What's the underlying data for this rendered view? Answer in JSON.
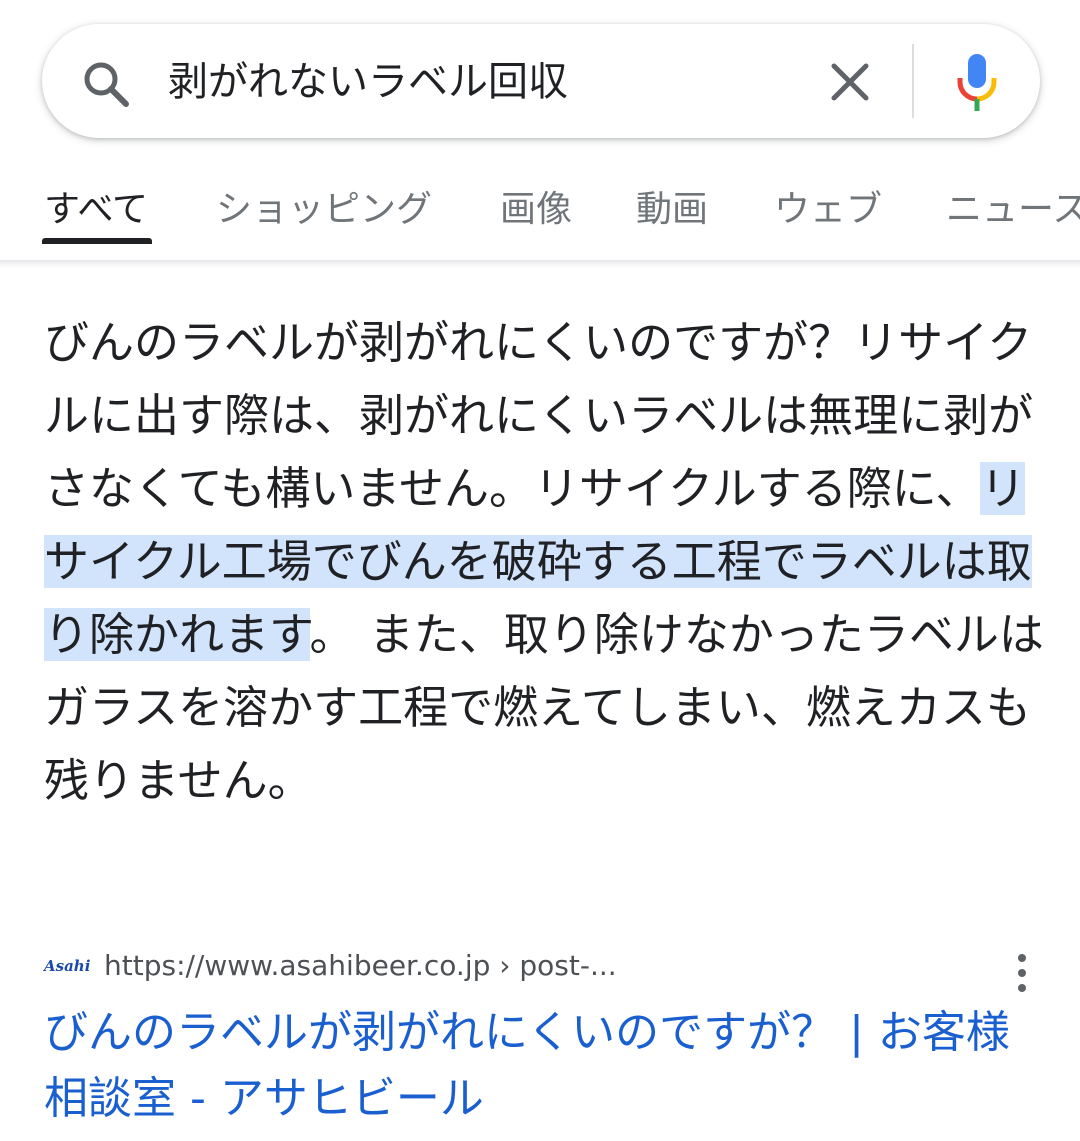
{
  "search": {
    "query": "剥がれないラベル回収"
  },
  "tabs": [
    {
      "label": "すべて",
      "active": true
    },
    {
      "label": "ショッピング",
      "active": false
    },
    {
      "label": "画像",
      "active": false
    },
    {
      "label": "動画",
      "active": false
    },
    {
      "label": "ウェブ",
      "active": false
    },
    {
      "label": "ニュース",
      "active": false
    }
  ],
  "answer": {
    "text_before": "びんのラベルが剥がれにくいのですが？リサイクルに出す際は、剥がれにくいラベルは無理に剥がさなくても構いません。リサイクルする際に、",
    "highlight": "リサイクル工場でびんを破砕する工程でラベルは取り除かれます",
    "text_after": "。 また、取り除けなかったラベルはガラスを溶かす工程で燃えてしまい、燃えカスも残りません。"
  },
  "result": {
    "favicon_text": "Asahi",
    "url": "https://www.asahibeer.co.jp › post-...",
    "title": "びんのラベルが剥がれにくいのですが？ | お客様相談室 - アサヒビール"
  },
  "colors": {
    "link": "#1a5fd0",
    "highlight": "#d2e3fc",
    "text": "#202124",
    "muted": "#70757a"
  },
  "icons": [
    "search-icon",
    "clear-icon",
    "microphone-icon",
    "more-vert-icon"
  ]
}
